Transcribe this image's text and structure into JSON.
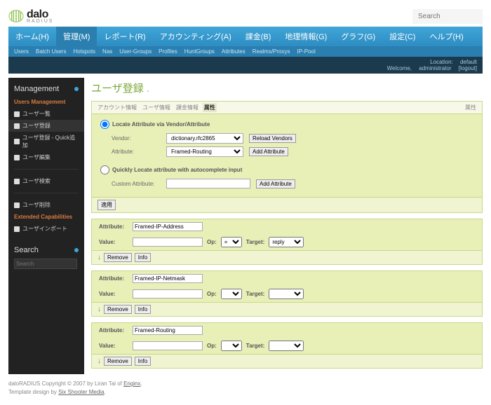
{
  "header": {
    "logo_main": "dalo",
    "logo_sub": "RADIUS",
    "search_placeholder": "Search"
  },
  "topnav": [
    {
      "label": "ホーム(H)"
    },
    {
      "label": "管理(M)",
      "active": true
    },
    {
      "label": "レポート(R)"
    },
    {
      "label": "アカウンティング(A)"
    },
    {
      "label": "課金(B)"
    },
    {
      "label": "地理情報(G)"
    },
    {
      "label": "グラフ(G)"
    },
    {
      "label": "設定(C)"
    },
    {
      "label": "ヘルプ(H)"
    }
  ],
  "subnav": [
    "Users",
    "Batch Users",
    "Hotspots",
    "Nas",
    "User-Groups",
    "Profiles",
    "HuntGroups",
    "Attributes",
    "Realms/Proxys",
    "IP-Pool"
  ],
  "statusbar": {
    "location": "Location:",
    "location_val": "default",
    "welcome": "Welcome,",
    "user": "administrator",
    "logout": "[logout]"
  },
  "sidebar": {
    "title": "Management",
    "section1": "Users Management",
    "items1": [
      {
        "label": "ユーザ一覧"
      },
      {
        "label": "ユーザ登録",
        "active": true
      },
      {
        "label": "ユーザ登録 - Quick追加"
      },
      {
        "label": "ユーザ編集"
      }
    ],
    "items2": [
      {
        "label": "ユーザ検索"
      }
    ],
    "items3": [
      {
        "label": "ユーザ削除"
      }
    ],
    "section2": "Extended Capabilities",
    "items4": [
      {
        "label": "ユーザインポート"
      }
    ],
    "search_title": "Search",
    "search_placeholder": "Search"
  },
  "page_title": "ユーザ登録",
  "tabs": [
    "アカウント情報",
    "ユーザ情報",
    "課金情報",
    "属性"
  ],
  "active_tab": 3,
  "tabs_right": "属性",
  "locate": {
    "radio1": "Locate Attribute via Vendor/Attribute",
    "vendor_label": "Vendor:",
    "vendor_value": "dictionary.rfc2865",
    "reload_btn": "Reload Vendors",
    "attr_label": "Attribute:",
    "attr_value": "Framed-Routing",
    "add_btn": "Add Attribute",
    "radio2": "Quickly Locate attribute with autocomplete input",
    "custom_label": "Custom Attribute:",
    "add_btn2": "Add Attribute",
    "apply_btn": "適用"
  },
  "attributes": [
    {
      "attr": "Framed-IP-Address",
      "value": "",
      "op": "=",
      "target": "reply"
    },
    {
      "attr": "Framed-IP-Netmask",
      "value": "",
      "op": "",
      "target": ""
    },
    {
      "attr": "Framed-Routing",
      "value": "",
      "op": "",
      "target": ""
    }
  ],
  "attr_labels": {
    "attribute": "Attribute:",
    "value": "Value:",
    "op": "Op:",
    "target": "Target:",
    "remove": "Remove",
    "info": "Info"
  },
  "footer": {
    "line1a": "daloRADIUS Copyright © 2007 by Liran Tal of ",
    "line1b": "Enginx",
    "line1c": ".",
    "line2a": "Template design by ",
    "line2b": "Six Shooter Media",
    "line2c": "."
  }
}
